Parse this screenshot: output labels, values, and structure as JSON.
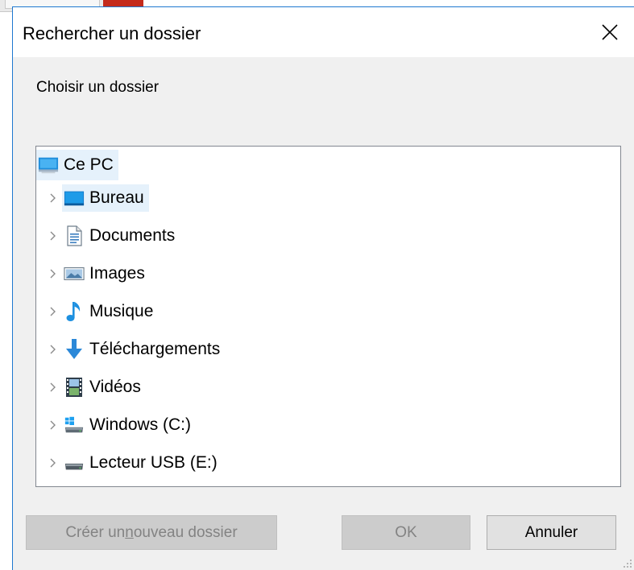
{
  "dialog": {
    "title": "Rechercher un dossier",
    "prompt": "Choisir un dossier",
    "close_label": "Fermer"
  },
  "tree": {
    "root": {
      "label": "Ce PC",
      "icon": "computer-icon"
    },
    "items": [
      {
        "label": "Bureau",
        "icon": "desktop-icon",
        "selected": true
      },
      {
        "label": "Documents",
        "icon": "documents-icon"
      },
      {
        "label": "Images",
        "icon": "pictures-icon"
      },
      {
        "label": "Musique",
        "icon": "music-icon"
      },
      {
        "label": "Téléchargements",
        "icon": "downloads-icon"
      },
      {
        "label": "Vidéos",
        "icon": "videos-icon"
      },
      {
        "label": "Windows (C:)",
        "icon": "windows-drive-icon"
      },
      {
        "label": "Lecteur USB (E:)",
        "icon": "usb-drive-icon"
      }
    ]
  },
  "buttons": {
    "new_folder_pre": "Créer un ",
    "new_folder_accel": "n",
    "new_folder_post": "ouveau dossier",
    "ok": "OK",
    "cancel": "Annuler"
  },
  "colors": {
    "accent_border": "#1e78d0",
    "selection": "#e5f1fb",
    "dialog_bg": "#f0f0f0"
  }
}
